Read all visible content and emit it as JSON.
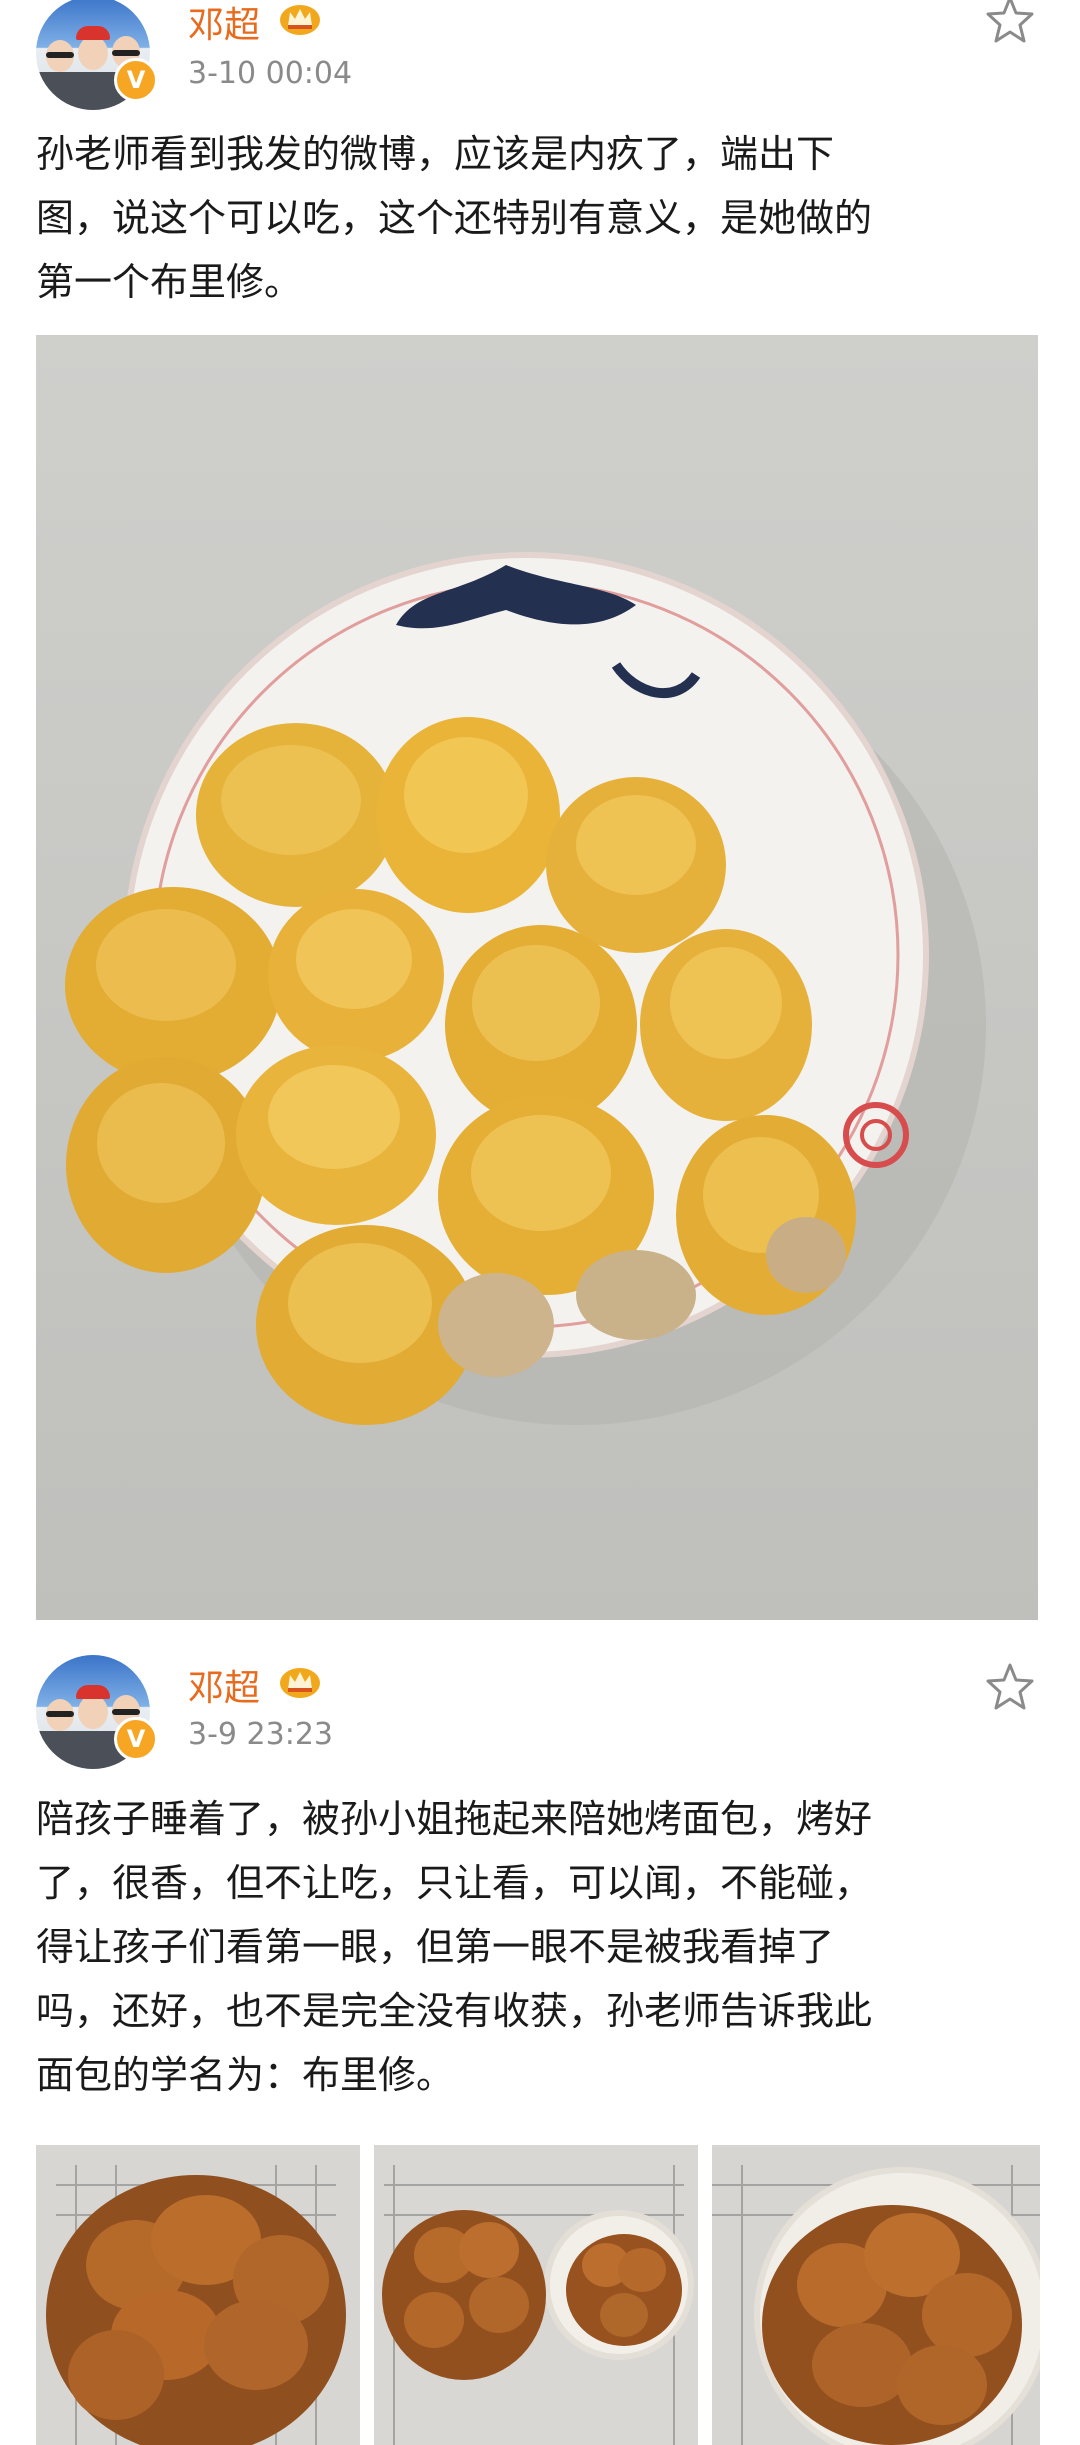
{
  "posts": [
    {
      "username": "邓超",
      "timestamp": "3-10 00:04",
      "text": "孙老师看到我发的微博，应该是内疚了，端出下\n图，说这个可以吃，这个还特别有意义，是她做的\n第一个布里修。",
      "verified_badge": "V",
      "image": "plate-of-golden-brioche-buns"
    },
    {
      "username": "邓超",
      "timestamp": "3-9 23:23",
      "text": "陪孩子睡着了，被孙小姐拖起来陪她烤面包，烤好\n了，很香，但不让吃，只让看，可以闻，不能碰，\n得让孩子们看第一眼，但第一眼不是被我看掉了\n吗，还好，也不是完全没有收获，孙老师告诉我此\n面包的学名为：布里修。",
      "verified_badge": "V",
      "images": [
        "brioche-on-rack-1",
        "brioche-on-rack-2",
        "brioche-on-rack-3"
      ]
    }
  ],
  "colors": {
    "username": "#e86a1c",
    "timestamp": "#8a8a8a",
    "badge": "#f6a623",
    "crown": "#f2a81d"
  },
  "icons": [
    "avatar",
    "verified-badge-icon",
    "crown-icon",
    "star-icon"
  ]
}
